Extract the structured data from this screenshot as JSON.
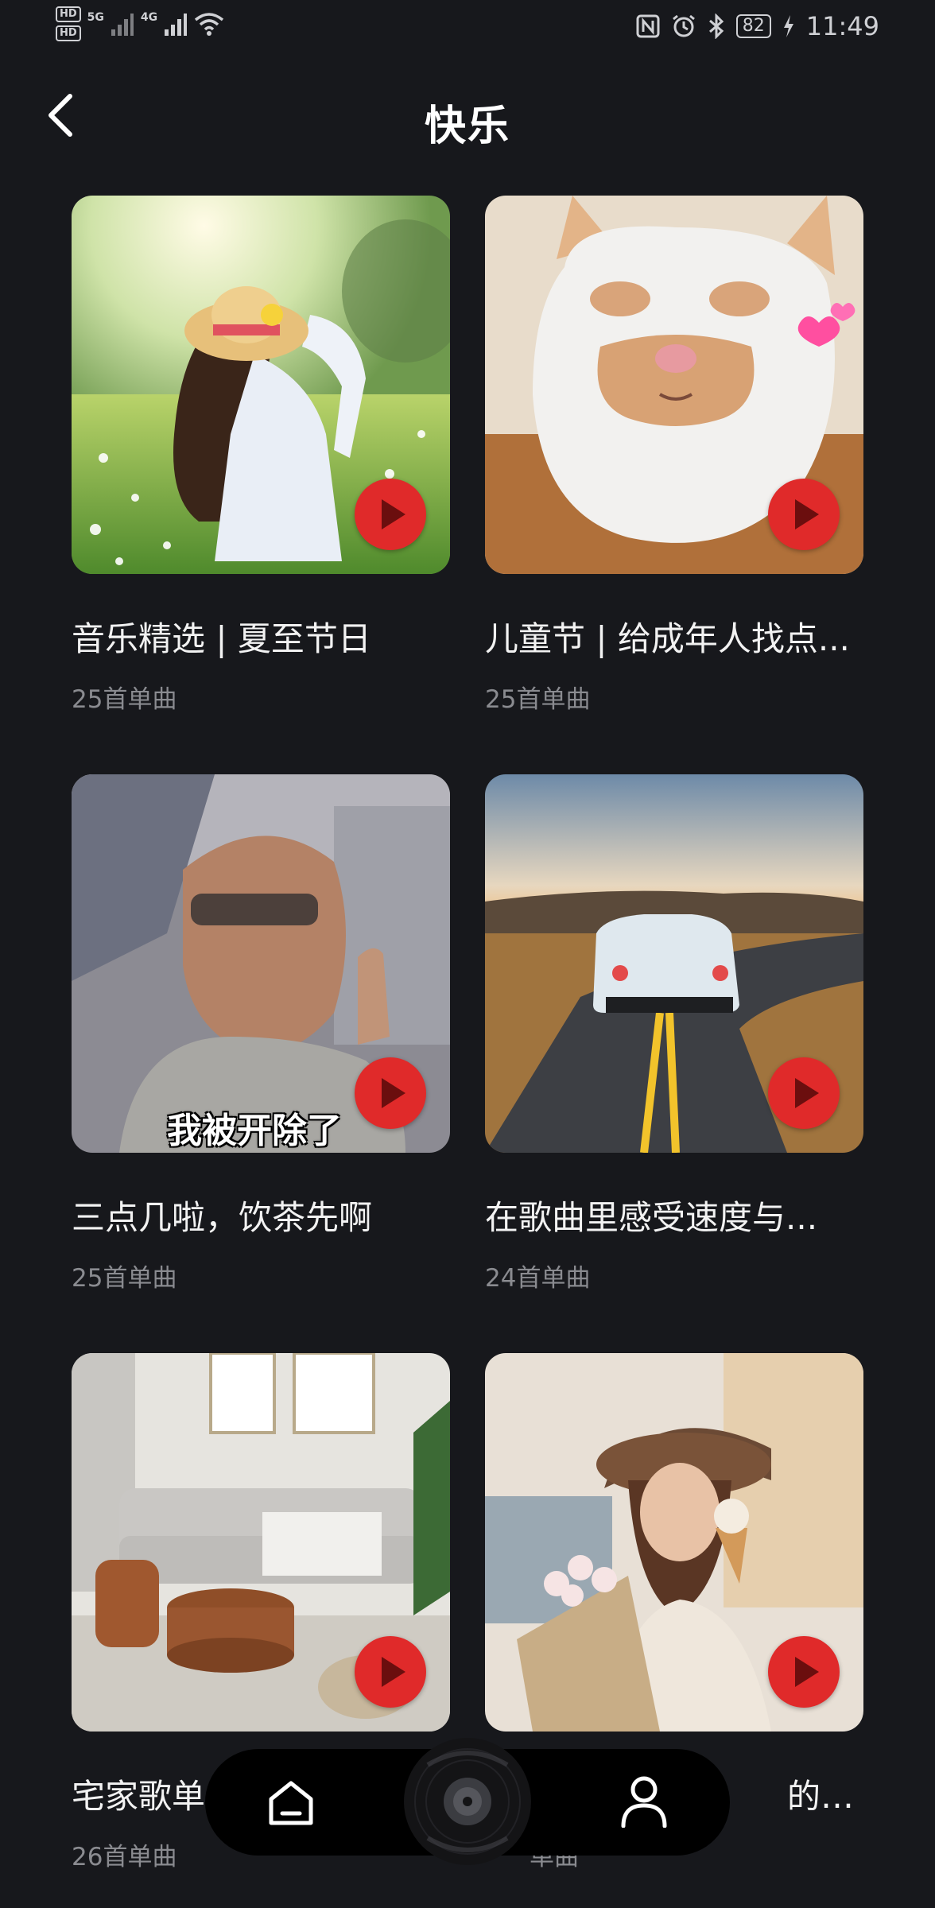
{
  "status_bar": {
    "network_badges": [
      "HD",
      "HD"
    ],
    "signal_labels": [
      "5G",
      "4G"
    ],
    "battery": "82",
    "time": "11:49"
  },
  "header": {
    "title": "快乐"
  },
  "playlists": [
    {
      "title": "音乐精选 | 夏至节日",
      "count": "25首单曲"
    },
    {
      "title": "儿童节 | 给成年人找点...",
      "count": "25首单曲"
    },
    {
      "title": "三点几啦，饮茶先啊",
      "count": "25首单曲",
      "cover_caption": "我被开除了"
    },
    {
      "title": "在歌曲里感受速度与...",
      "count": "24首单曲"
    },
    {
      "title": "宅家歌单",
      "count": "26首单曲"
    },
    {
      "title": "的地...",
      "count": "单曲"
    }
  ],
  "bottom_nav": {
    "items": [
      "home-icon",
      "vinyl-record-icon",
      "profile-icon"
    ]
  },
  "colors": {
    "background": "#17181c",
    "play_button": "#e02a2a",
    "secondary_text": "#8a8b90"
  }
}
